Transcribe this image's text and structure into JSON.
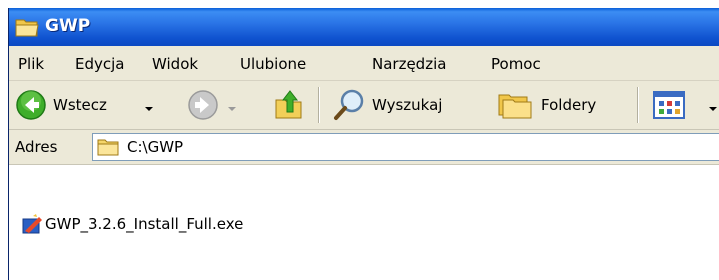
{
  "window": {
    "title": "GWP"
  },
  "menu": [
    {
      "label": "Plik"
    },
    {
      "label": "Edycja"
    },
    {
      "label": "Widok"
    },
    {
      "label": "Ulubione"
    },
    {
      "label": "Narzędzia"
    },
    {
      "label": "Pomoc"
    }
  ],
  "toolbar": {
    "back_label": "Wstecz",
    "search_label": "Wyszukaj",
    "folders_label": "Foldery"
  },
  "address": {
    "label": "Adres",
    "value": "C:\\GWP"
  },
  "files": [
    {
      "name": "GWP_3.2.6_Install_Full.exe",
      "icon": "installer-icon"
    }
  ],
  "colors": {
    "titlebar": "#0c5ad6",
    "chrome": "#ece9d8",
    "folder": "#f5d56a"
  }
}
